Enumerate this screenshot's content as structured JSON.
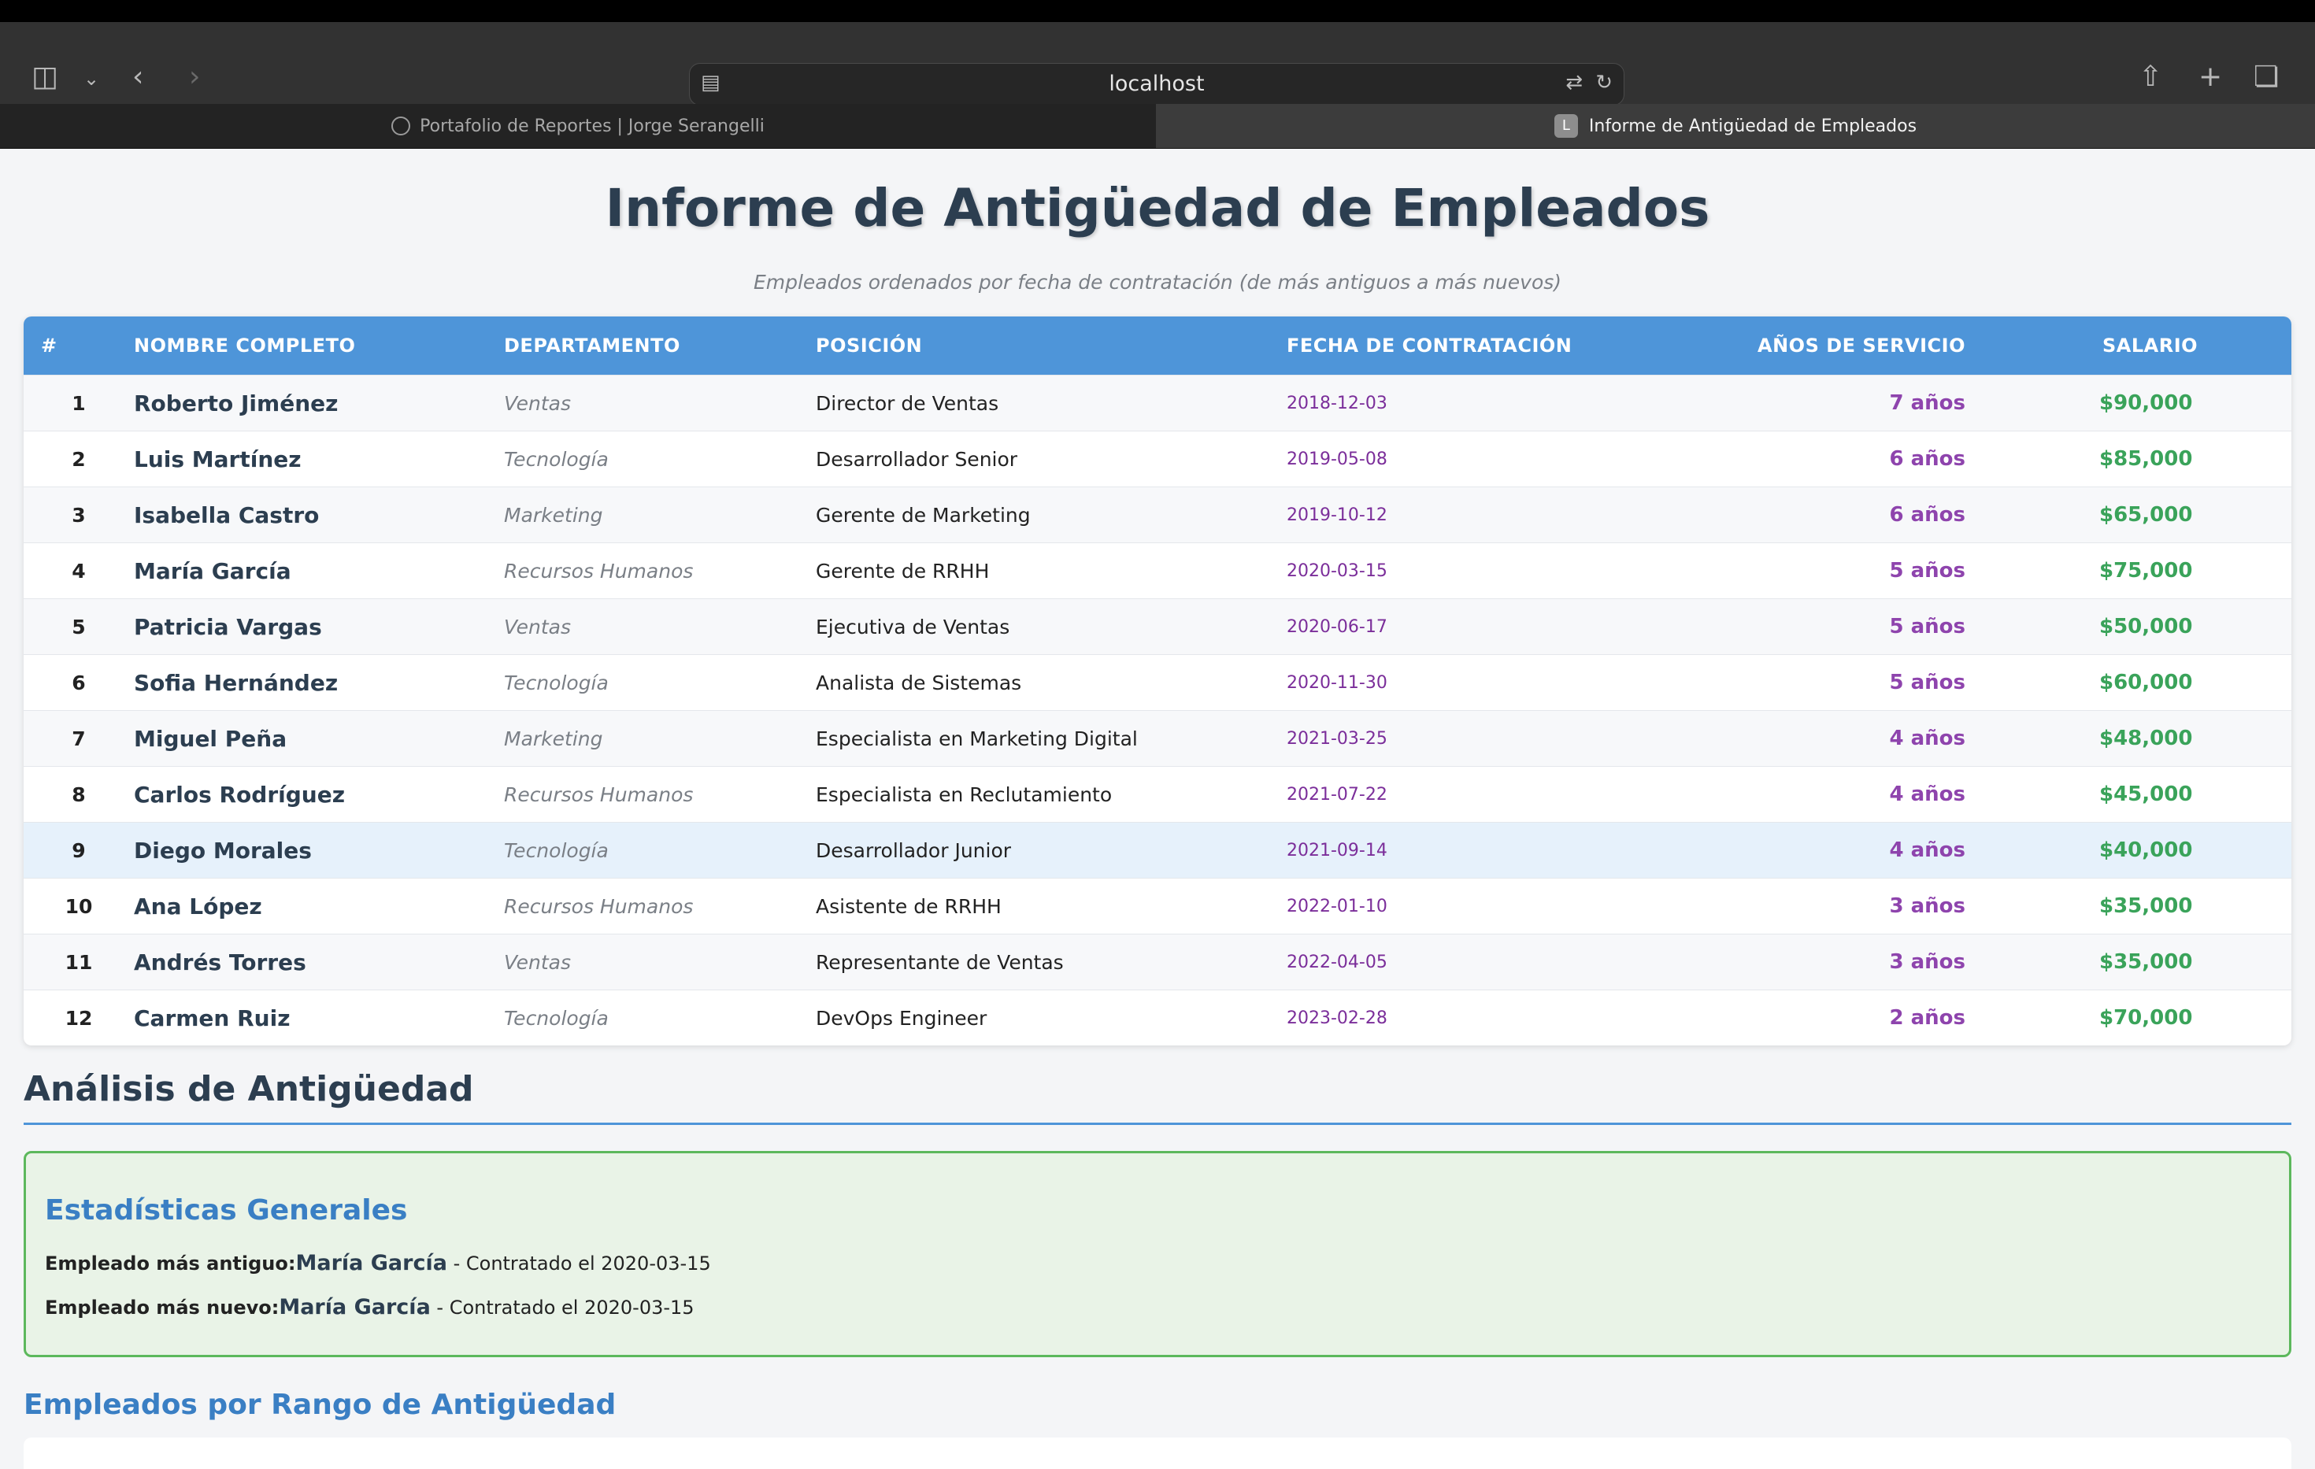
{
  "browser": {
    "url": "localhost",
    "tabs": [
      {
        "label": "Portafolio de Reportes | Jorge Serangelli",
        "active": false
      },
      {
        "label": "Informe de Antigüedad de Empleados",
        "active": true,
        "favicon": "L"
      }
    ]
  },
  "page": {
    "title": "Informe de Antigüedad de Empleados",
    "subtitle": "Empleados ordenados por fecha de contratación (de más antiguos a más nuevos)"
  },
  "table": {
    "headers": [
      "#",
      "NOMBRE COMPLETO",
      "DEPARTAMENTO",
      "POSICIÓN",
      "FECHA DE CONTRATACIÓN",
      "AÑOS DE SERVICIO",
      "SALARIO"
    ],
    "rows": [
      [
        "1",
        "Roberto Jiménez",
        "Ventas",
        "Director de Ventas",
        "2018-12-03",
        "7 años",
        "$90,000"
      ],
      [
        "2",
        "Luis Martínez",
        "Tecnología",
        "Desarrollador Senior",
        "2019-05-08",
        "6 años",
        "$85,000"
      ],
      [
        "3",
        "Isabella Castro",
        "Marketing",
        "Gerente de Marketing",
        "2019-10-12",
        "6 años",
        "$65,000"
      ],
      [
        "4",
        "María García",
        "Recursos Humanos",
        "Gerente de RRHH",
        "2020-03-15",
        "5 años",
        "$75,000"
      ],
      [
        "5",
        "Patricia Vargas",
        "Ventas",
        "Ejecutiva de Ventas",
        "2020-06-17",
        "5 años",
        "$50,000"
      ],
      [
        "6",
        "Sofia Hernández",
        "Tecnología",
        "Analista de Sistemas",
        "2020-11-30",
        "5 años",
        "$60,000"
      ],
      [
        "7",
        "Miguel Peña",
        "Marketing",
        "Especialista en Marketing Digital",
        "2021-03-25",
        "4 años",
        "$48,000"
      ],
      [
        "8",
        "Carlos Rodríguez",
        "Recursos Humanos",
        "Especialista en Reclutamiento",
        "2021-07-22",
        "4 años",
        "$45,000"
      ],
      [
        "9",
        "Diego Morales",
        "Tecnología",
        "Desarrollador Junior",
        "2021-09-14",
        "4 años",
        "$40,000"
      ],
      [
        "10",
        "Ana López",
        "Recursos Humanos",
        "Asistente de RRHH",
        "2022-01-10",
        "3 años",
        "$35,000"
      ],
      [
        "11",
        "Andrés Torres",
        "Ventas",
        "Representante de Ventas",
        "2022-04-05",
        "3 años",
        "$35,000"
      ],
      [
        "12",
        "Carmen Ruiz",
        "Tecnología",
        "DevOps Engineer",
        "2023-02-28",
        "2 años",
        "$70,000"
      ]
    ],
    "highlighted_row": 9
  },
  "analysis": {
    "heading": "Análisis de Antigüedad",
    "stats": {
      "heading": "Estadísticas Generales",
      "oldest_label": "Empleado más antiguo:",
      "oldest_name": "María García",
      "oldest_suffix": " - Contratado el 2020-03-15",
      "newest_label": "Empleado más nuevo:",
      "newest_name": "María García",
      "newest_suffix": " - Contratado el 2020-03-15"
    },
    "ranges_heading": "Empleados por Rango de Antigüedad"
  },
  "colors": {
    "header_blue": "#4e95d9",
    "title": "#2c3e50",
    "years": "#8e44ad",
    "salary": "#3aa35a",
    "stat_border": "#5cb85c"
  }
}
